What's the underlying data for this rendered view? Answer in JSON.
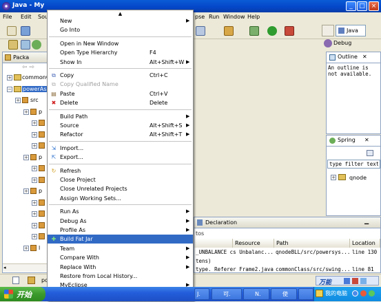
{
  "window": {
    "title": "Java - My"
  },
  "menubar": {
    "file": "File",
    "edit": "Edit",
    "source": "Sou",
    "eclipse": "pse",
    "run": "Run",
    "window": "Window",
    "help": "Help"
  },
  "perspectives": {
    "java": "Java",
    "debug": "Debug"
  },
  "package_explorer": {
    "tab_label": "Packa",
    "rows": [
      "commonCl",
      "powerAs",
      "src",
      "p",
      "p",
      "p",
      "p",
      "p",
      "p",
      "p",
      "p",
      "p",
      "p",
      "p",
      "p",
      "l"
    ]
  },
  "outline": {
    "tab_label": "Outline",
    "message": "An outline is not available."
  },
  "spring": {
    "tab_label": "Spring",
    "filter_value": "type filter text",
    "node": "qnode"
  },
  "bottom": {
    "tab_declaration": "Declaration",
    "subtitle": "tos",
    "columns": [
      "Resource",
      "Path",
      "Location"
    ],
    "rows": [
      {
        "desc": "_UNBALANCE cs Unbalanc...",
        "resource": "",
        "path": "qnodeBLL/src/powersys...",
        "location": "line 130"
      },
      {
        "desc": "tens)",
        "resource": "",
        "path": "",
        "location": ""
      },
      {
        "desc": "type. Referer Frame2.java",
        "resource": "",
        "path": "commonClass/src/swing...",
        "location": "line 81"
      }
    ]
  },
  "context_menu": {
    "items": [
      {
        "label": "New",
        "shortcut": "",
        "submenu": true
      },
      {
        "label": "Go Into",
        "shortcut": "",
        "submenu": false
      },
      {
        "sep": true
      },
      {
        "label": "Open in New Window",
        "shortcut": "",
        "submenu": false
      },
      {
        "label": "Open Type Hierarchy",
        "shortcut": "F4",
        "submenu": false
      },
      {
        "label": "Show In",
        "shortcut": "Alt+Shift+W",
        "submenu": true
      },
      {
        "sep": true
      },
      {
        "label": "Copy",
        "shortcut": "Ctrl+C",
        "submenu": false,
        "icon": "copy"
      },
      {
        "label": "Copy Qualified Name",
        "shortcut": "",
        "submenu": false,
        "disabled": true,
        "icon": "copyq"
      },
      {
        "label": "Paste",
        "shortcut": "Ctrl+V",
        "submenu": false,
        "icon": "paste"
      },
      {
        "label": "Delete",
        "shortcut": "Delete",
        "submenu": false,
        "icon": "delete"
      },
      {
        "sep": true
      },
      {
        "label": "Build Path",
        "shortcut": "",
        "submenu": true
      },
      {
        "label": "Source",
        "shortcut": "Alt+Shift+S",
        "submenu": true
      },
      {
        "label": "Refactor",
        "shortcut": "Alt+Shift+T",
        "submenu": true
      },
      {
        "sep": true
      },
      {
        "label": "Import...",
        "shortcut": "",
        "submenu": false,
        "icon": "import"
      },
      {
        "label": "Export...",
        "shortcut": "",
        "submenu": false,
        "icon": "export"
      },
      {
        "sep": true
      },
      {
        "label": "Refresh",
        "shortcut": "",
        "submenu": false,
        "icon": "refresh"
      },
      {
        "label": "Close Project",
        "shortcut": "",
        "submenu": false
      },
      {
        "label": "Close Unrelated Projects",
        "shortcut": "",
        "submenu": false
      },
      {
        "label": "Assign Working Sets...",
        "shortcut": "",
        "submenu": false
      },
      {
        "sep": true
      },
      {
        "label": "Run As",
        "shortcut": "",
        "submenu": true
      },
      {
        "label": "Debug As",
        "shortcut": "",
        "submenu": true
      },
      {
        "label": "Profile As",
        "shortcut": "",
        "submenu": true
      },
      {
        "label": "Build Fat Jar",
        "shortcut": "",
        "submenu": false,
        "highlight": true,
        "icon": "fatjar"
      },
      {
        "label": "Team",
        "shortcut": "",
        "submenu": true
      },
      {
        "label": "Compare With",
        "shortcut": "",
        "submenu": true
      },
      {
        "label": "Replace With",
        "shortcut": "",
        "submenu": true
      },
      {
        "label": "Restore from Local History...",
        "shortcut": "",
        "submenu": false
      },
      {
        "label": "MyEclipse",
        "shortcut": "",
        "submenu": true
      }
    ]
  },
  "statusbar": {
    "left_text": "po"
  },
  "taskbar": {
    "start": "开始",
    "tasks": [
      "J.",
      "可.",
      "N.",
      "使",
      "我的电脑"
    ],
    "ime": "万能"
  }
}
